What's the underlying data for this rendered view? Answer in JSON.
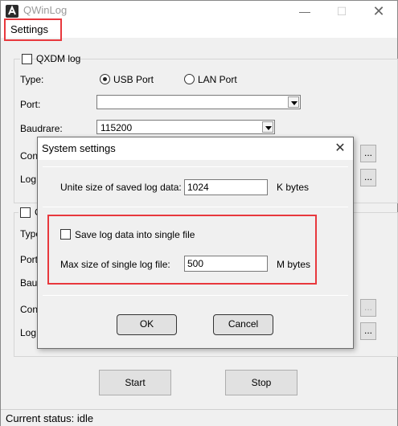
{
  "window": {
    "title": "QWinLog",
    "min_glyph": "—",
    "max_glyph": "☐",
    "close_glyph": "✕"
  },
  "menu": {
    "settings": "Settings"
  },
  "qxdm": {
    "group_label": "QXDM log",
    "type_label": "Type:",
    "usb_label": "USB Port",
    "lan_label": "LAN Port",
    "port_label": "Port:",
    "port_value": "",
    "baud_label": "Baudrare:",
    "baud_value": "115200",
    "config_label": "Confi",
    "log_label": "Log p"
  },
  "second": {
    "group_label": "C",
    "type_label": "Type:",
    "port_label": "Port:",
    "baud_label": "Baudr",
    "config_label": "Confi",
    "log_label": "Log p"
  },
  "ellipsis": "...",
  "buttons": {
    "start": "Start",
    "stop": "Stop"
  },
  "status": "Current status: idle",
  "dialog": {
    "title": "System settings",
    "close_glyph": "✕",
    "unit_size_label": "Unite size of saved log data:",
    "unit_size_value": "1024",
    "unit_size_unit": "K bytes",
    "single_file_label": "Save log data into single file",
    "single_file_checked": false,
    "max_size_label": "Max size of single log file:",
    "max_size_value": "500",
    "max_size_unit": "M bytes",
    "ok": "OK",
    "cancel": "Cancel"
  },
  "colors": {
    "highlight": "#e8383d",
    "window_bg": "#f0f0f0"
  }
}
